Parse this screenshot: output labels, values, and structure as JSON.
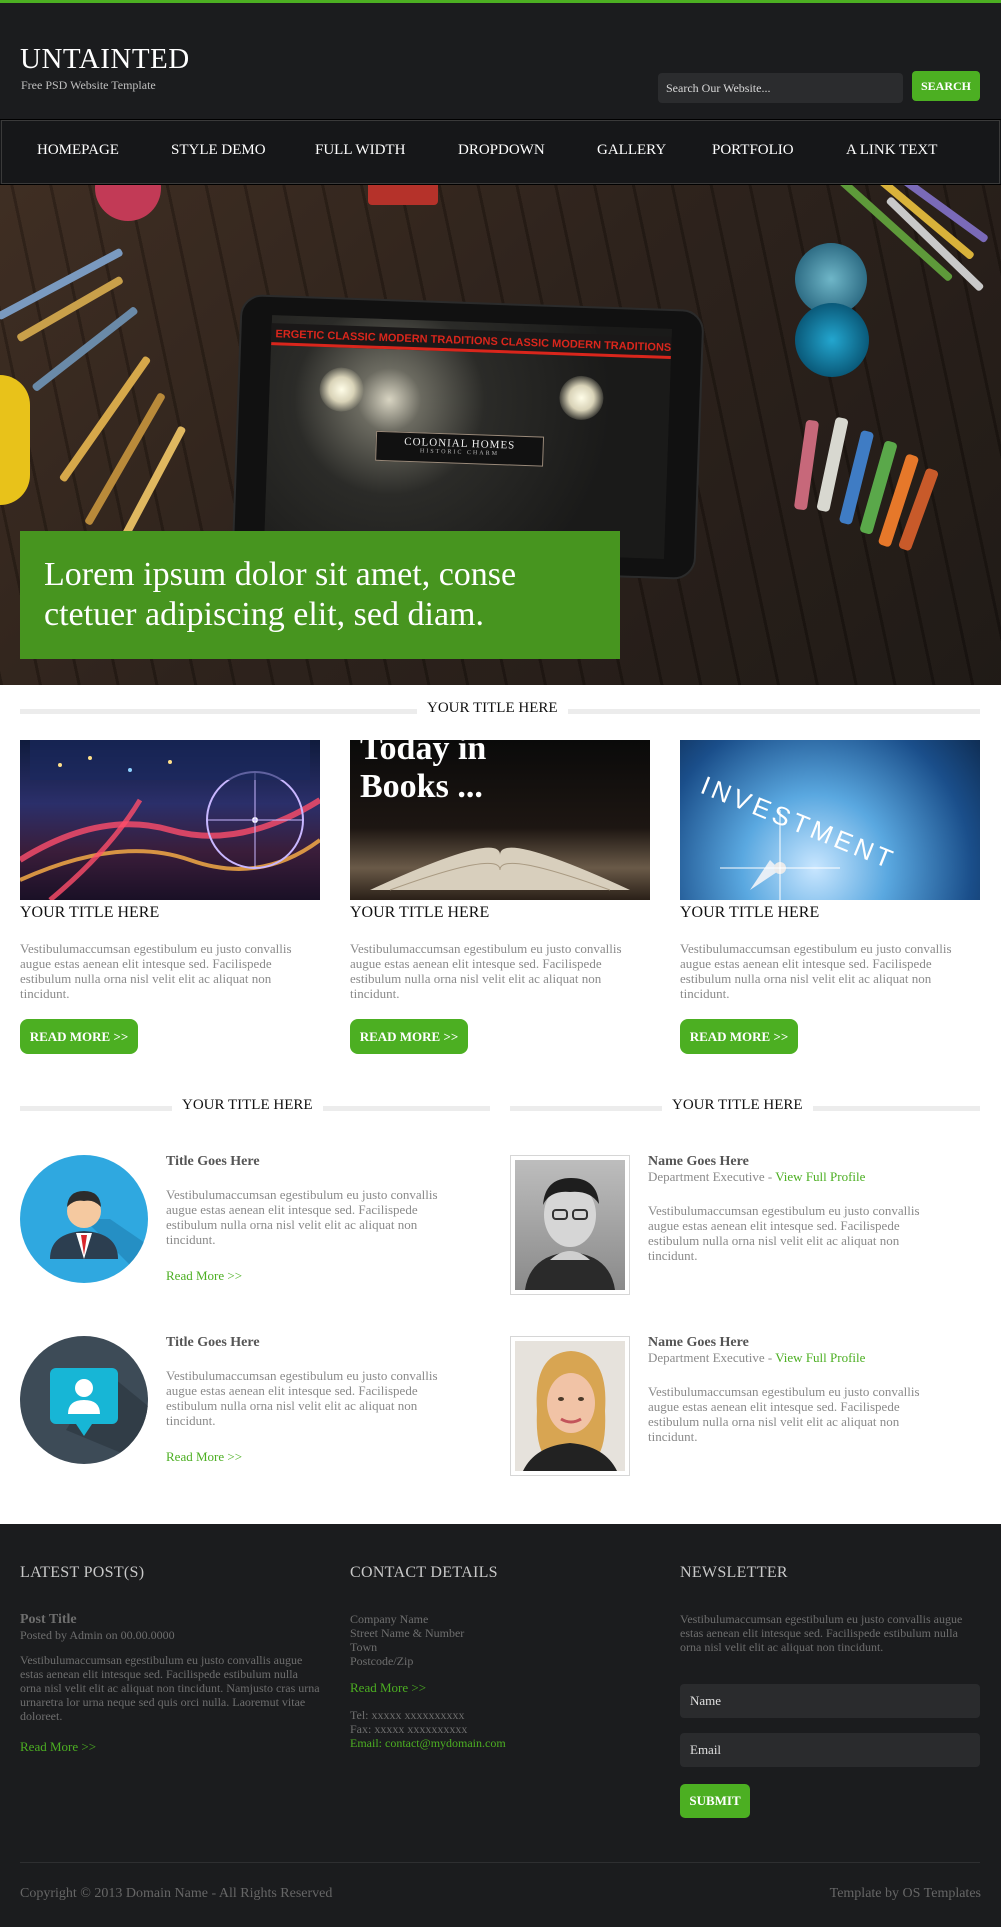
{
  "colors": {
    "accent": "#4caf22",
    "header_bg": "#1b1c1e",
    "hero_caption_bg": "#47951f"
  },
  "header": {
    "logo": "UNTAINTED",
    "tagline": "Free PSD Website Template",
    "search_placeholder": "Search Our Website...",
    "search_button": "SEARCH"
  },
  "nav": {
    "items": [
      "HOMEPAGE",
      "STYLE DEMO",
      "FULL WIDTH",
      "DROPDOWN",
      "GALLERY",
      "PORTFOLIO",
      "A LINK TEXT"
    ]
  },
  "hero": {
    "caption_line1": "Lorem ipsum dolor sit amet, conse",
    "caption_line2": "ctetuer adipiscing elit, sed diam.",
    "tablet_band": "ERGETIC CLASSIC MODERN TRADITIONS CLASSIC MODERN TRADITIONS",
    "tablet_plaque": "COLONIAL HOMES",
    "tablet_plaque_sub": "HISTORIC CHARM"
  },
  "section1": {
    "title": "YOUR TITLE HERE",
    "cards": [
      {
        "image": "city-night-ferris-wheel",
        "title": "YOUR TITLE HERE",
        "body": "Vestibulumaccumsan egestibulum eu justo convallis augue estas aenean elit intesque sed. Facilispede estibulum nulla orna nisl velit elit ac aliquat non tincidunt.",
        "button": "READ MORE >>"
      },
      {
        "image": "open-book",
        "image_text_line1": "Today in",
        "image_text_line2": "Books ...",
        "title": "YOUR TITLE HERE",
        "body": "Vestibulumaccumsan egestibulum eu justo convallis augue estas aenean elit intesque sed. Facilispede estibulum nulla orna nisl velit elit ac aliquat non tincidunt.",
        "button": "READ MORE >>"
      },
      {
        "image": "investment-compass",
        "image_text": "INVESTMENT",
        "title": "YOUR TITLE HERE",
        "body": "Vestibulumaccumsan egestibulum eu justo convallis augue estas aenean elit intesque sed. Facilispede estibulum nulla orna nisl velit elit ac aliquat non tincidunt.",
        "button": "READ MORE >>"
      }
    ]
  },
  "section2": {
    "left_title": "YOUR TITLE HERE",
    "right_title": "YOUR TITLE HERE",
    "left_items": [
      {
        "icon": "businessman-icon",
        "title": "Title Goes Here",
        "body": "Vestibulumaccumsan egestibulum eu justo convallis augue estas aenean elit intesque sed. Facilispede estibulum nulla orna nisl velit elit ac aliquat non tincidunt.",
        "link": "Read More >>"
      },
      {
        "icon": "user-profile-icon",
        "title": "Title Goes Here",
        "body": "Vestibulumaccumsan egestibulum eu justo convallis augue estas aenean elit intesque sed. Facilispede estibulum nulla orna nisl velit elit ac aliquat non tincidunt.",
        "link": "Read More >>"
      }
    ],
    "right_items": [
      {
        "photo": "man-portrait",
        "name": "Name Goes Here",
        "role": "Department Executive - ",
        "link": "View Full Profile",
        "body": "Vestibulumaccumsan egestibulum eu justo convallis augue estas aenean elit intesque sed. Facilispede estibulum nulla orna nisl velit elit ac aliquat non tincidunt."
      },
      {
        "photo": "woman-portrait",
        "name": "Name Goes Here",
        "role": "Department Executive - ",
        "link": "View Full Profile",
        "body": "Vestibulumaccumsan egestibulum eu justo convallis augue estas aenean elit intesque sed. Facilispede estibulum nulla orna nisl velit elit ac aliquat non tincidunt."
      }
    ]
  },
  "footer": {
    "latest": {
      "heading": "LATEST POST(S)",
      "post_title": "Post Title",
      "posted_by": "Posted by Admin on 00.00.0000",
      "body": "Vestibulumaccumsan egestibulum eu justo convallis augue estas aenean elit intesque sed. Facilispede estibulum nulla orna nisl velit elit ac aliquat non tincidunt. Namjusto cras urna urnaretra lor urna neque sed quis orci nulla. Laoremut vitae doloreet.",
      "link": "Read More >>"
    },
    "contact": {
      "heading": "CONTACT DETAILS",
      "lines": [
        "Company Name",
        "Street Name & Number",
        "Town",
        "Postcode/Zip"
      ],
      "link": "Read More >>",
      "tel": "Tel: xxxxx xxxxxxxxxx",
      "fax": "Fax: xxxxx xxxxxxxxxx",
      "email": "Email: contact@mydomain.com"
    },
    "newsletter": {
      "heading": "NEWSLETTER",
      "body": "Vestibulumaccumsan egestibulum eu justo convallis augue estas aenean elit intesque sed. Facilispede estibulum nulla orna nisl velit elit ac aliquat non tincidunt.",
      "name_placeholder": "Name",
      "email_placeholder": "Email",
      "submit": "SUBMIT"
    },
    "copyright": "Copyright © 2013 Domain Name - All Rights Reserved",
    "credit": "Template by OS Templates"
  }
}
